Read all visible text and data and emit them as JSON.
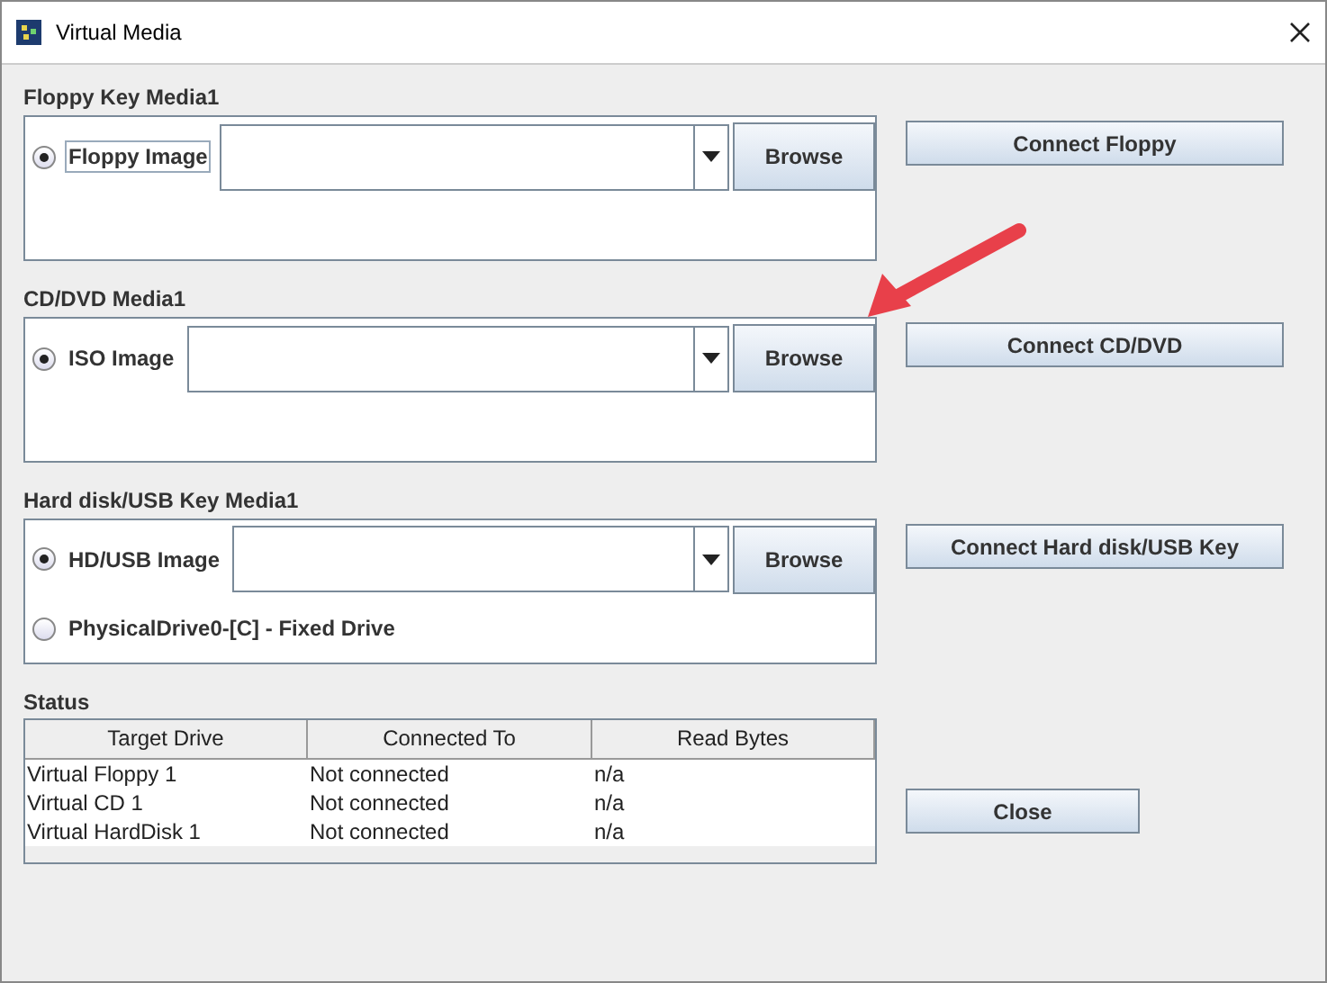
{
  "window": {
    "title": "Virtual Media"
  },
  "sections": [
    {
      "title": "Floppy Key Media1",
      "connect_button": "Connect Floppy",
      "options": [
        {
          "kind": "image",
          "label": "Floppy Image",
          "selected": true,
          "focused": true,
          "browse": "Browse"
        }
      ]
    },
    {
      "title": "CD/DVD Media1",
      "connect_button": "Connect CD/DVD",
      "options": [
        {
          "kind": "image",
          "label": "ISO Image",
          "selected": true,
          "focused": false,
          "browse": "Browse"
        }
      ]
    },
    {
      "title": "Hard disk/USB Key Media1",
      "connect_button": "Connect Hard disk/USB Key",
      "options": [
        {
          "kind": "image",
          "label": "HD/USB Image",
          "selected": true,
          "focused": false,
          "browse": "Browse"
        },
        {
          "kind": "drive",
          "label": "PhysicalDrive0-[C] - Fixed Drive",
          "selected": false,
          "focused": false
        }
      ]
    }
  ],
  "status": {
    "title": "Status",
    "columns": [
      "Target Drive",
      "Connected To",
      "Read Bytes"
    ],
    "rows": [
      [
        "Virtual Floppy 1",
        "Not connected",
        "n/a"
      ],
      [
        "Virtual CD 1",
        "Not connected",
        "n/a"
      ],
      [
        "Virtual HardDisk 1",
        "Not connected",
        "n/a"
      ]
    ]
  },
  "close_button": "Close"
}
